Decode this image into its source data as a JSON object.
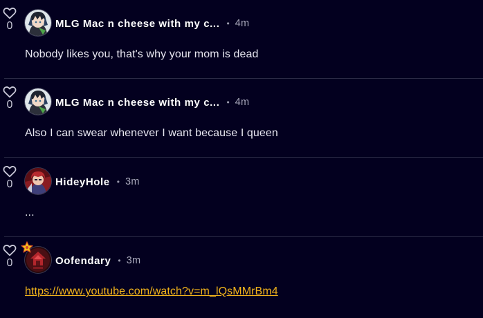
{
  "comments": [
    {
      "username": "MLG Mac n cheese with my c...",
      "time": "4m",
      "text": "Nobody likes you, that's why your mom is dead",
      "likes": "0",
      "avatar": "avatar-anime-character"
    },
    {
      "username": "MLG Mac n cheese with my c...",
      "time": "4m",
      "text": "Also I can swear whenever I want because I queen",
      "likes": "0",
      "avatar": "avatar-anime-character"
    },
    {
      "username": "HideyHole",
      "time": "3m",
      "text": "...",
      "likes": "0",
      "avatar": "avatar-red-character"
    },
    {
      "username": "Oofendary",
      "time": "3m",
      "text": "https://www.youtube.com/watch?v=m_lQsMMrBm4",
      "likes": "0",
      "avatar": "avatar-dark-red-emblem",
      "badge": "star-badge-icon"
    }
  ],
  "separator": "•",
  "colors": {
    "background": "#03001f",
    "link": "#f2b31b",
    "username": "#ffffff",
    "meta": "#a9a8bb",
    "divider": "#2b2a45"
  }
}
